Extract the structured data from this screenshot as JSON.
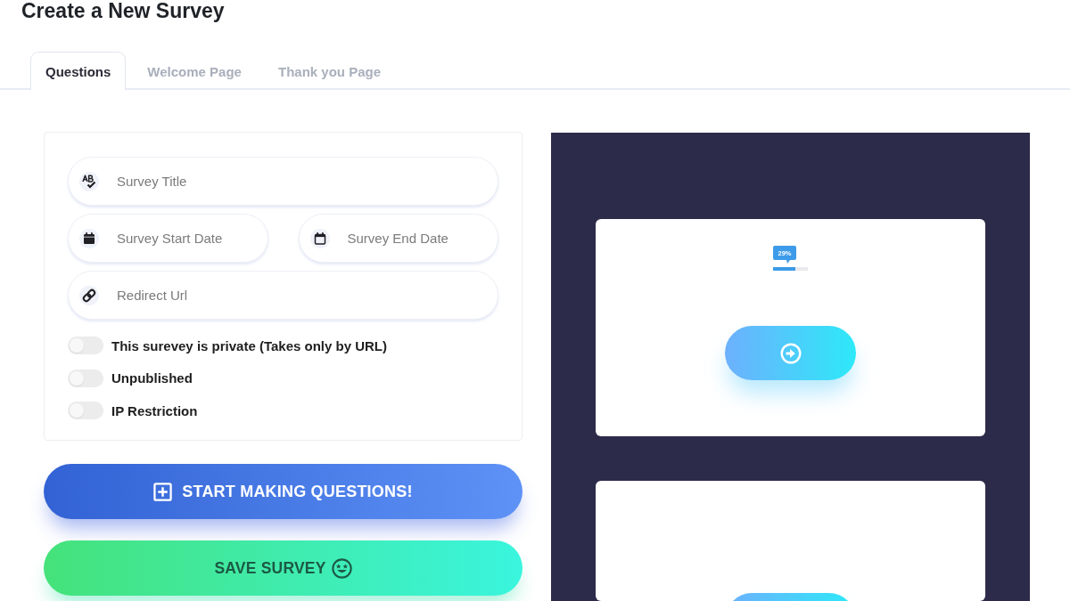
{
  "page_title": "Create a New Survey",
  "tabs": [
    {
      "label": "Questions",
      "selected": true
    },
    {
      "label": "Welcome Page",
      "selected": false
    },
    {
      "label": "Thank you Page",
      "selected": false
    }
  ],
  "form": {
    "field_rows": [
      {
        "fields": [
          {
            "kind": "title",
            "placeholder": "Survey Title"
          }
        ]
      },
      {
        "fields": [
          {
            "kind": "start",
            "placeholder": "Survey Start Date"
          },
          {
            "kind": "end",
            "placeholder": "Survey End Date"
          }
        ]
      },
      {
        "fields": [
          {
            "kind": "url",
            "placeholder": "Redirect Url"
          }
        ]
      }
    ],
    "toggles": [
      {
        "label": "This surevey is private (Takes only by URL)",
        "on": false
      },
      {
        "label": "Unpublished",
        "on": false
      },
      {
        "label": "IP Restriction",
        "on": false
      }
    ]
  },
  "buttons": [
    {
      "kind": "primary",
      "label": "START MAKING QUESTIONS!"
    },
    {
      "kind": "save",
      "label": "SAVE SURVEY"
    }
  ],
  "preview": {
    "cards": [
      {
        "kind": "question",
        "badge": "29%",
        "level": 0.65
      },
      {
        "kind": "partial"
      }
    ]
  }
}
